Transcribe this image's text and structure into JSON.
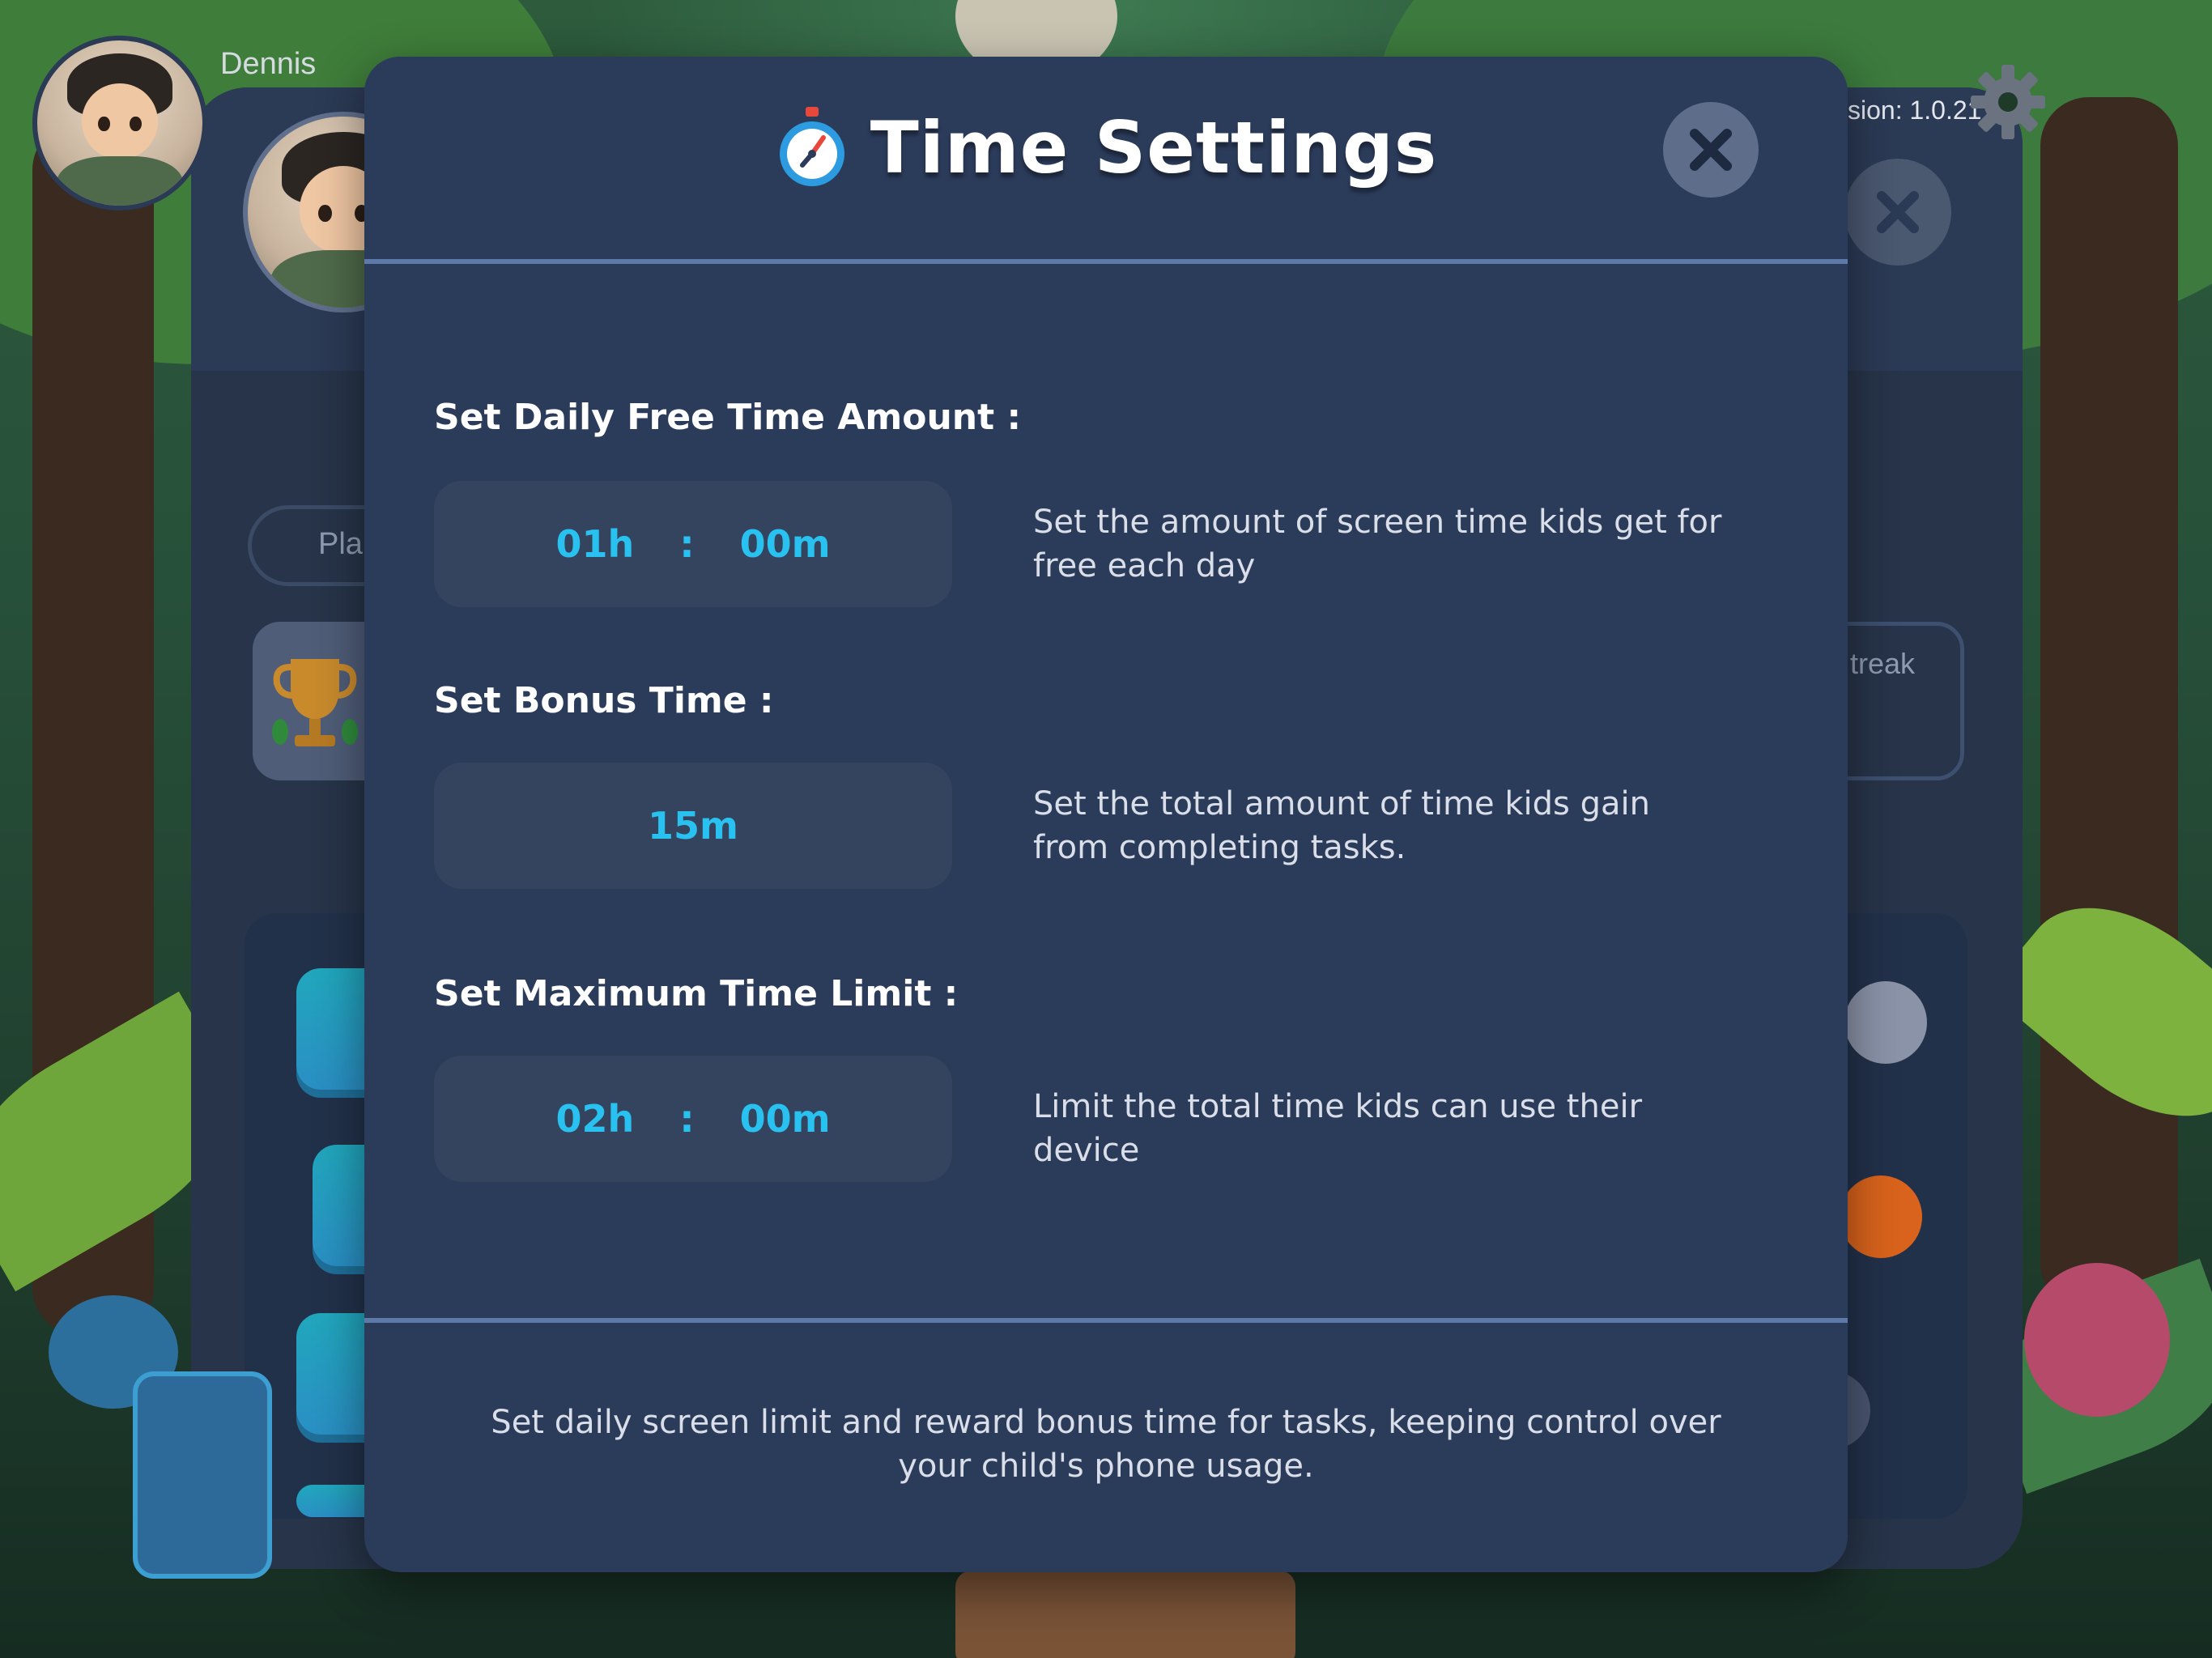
{
  "background": {
    "username": "Dennis",
    "version": "sion: 1.0.21",
    "play_button": "Pla",
    "streak_label": "treak"
  },
  "modal": {
    "title": "Time Settings",
    "icon": "stopwatch-icon",
    "daily": {
      "label": "Set Daily Free Time Amount :",
      "hours": "01h",
      "separator": ":",
      "minutes": "00m",
      "description": "Set the amount of screen time kids get for free each day"
    },
    "bonus": {
      "label": "Set Bonus Time :",
      "value": "15m",
      "description": "Set the total amount of time kids gain from completing tasks."
    },
    "max": {
      "label": "Set Maximum Time Limit :",
      "hours": "02h",
      "separator": ":",
      "minutes": "00m",
      "description": "Limit the total time kids can use their device"
    },
    "footer": "Set daily screen limit and reward bonus time for tasks, keeping control over your child's phone usage."
  },
  "colors": {
    "modal_bg": "#2b3b5a",
    "input_bg": "#34445f",
    "accent_value": "#29c2f0",
    "divider": "#5e7aa8"
  }
}
